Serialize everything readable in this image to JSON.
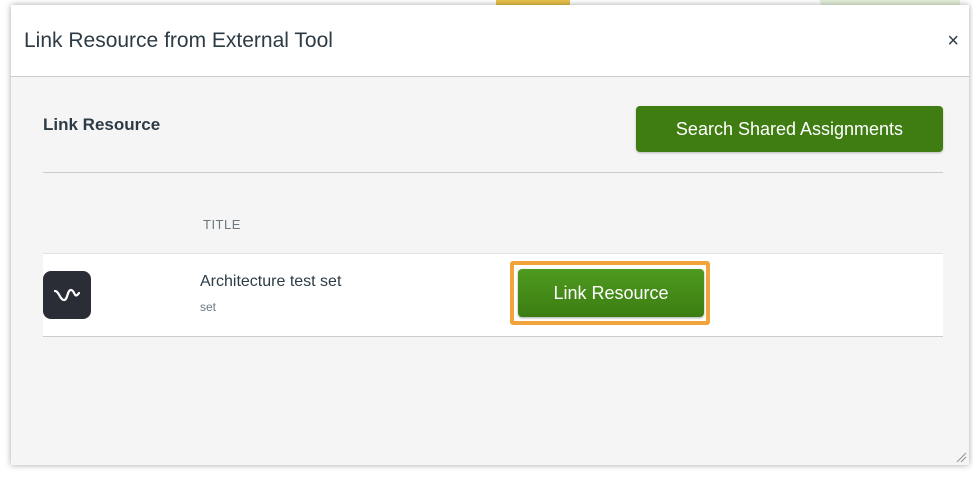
{
  "dialog": {
    "title": "Link Resource from External Tool",
    "close_label": "×"
  },
  "body": {
    "section_title": "Link Resource",
    "search_button_label": "Search Shared Assignments",
    "column_header": "TITLE",
    "resources": [
      {
        "icon": "wave-logo-icon",
        "title": "Architecture test set",
        "subtitle": "set",
        "action_label": "Link Resource"
      }
    ]
  },
  "colors": {
    "primary_button": "#3f7d12",
    "highlight": "#f0a43a",
    "text": "#2d3b45"
  }
}
